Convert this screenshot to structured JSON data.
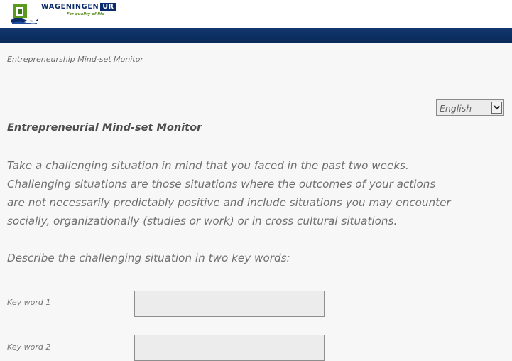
{
  "header": {
    "logo": {
      "wordmark": "WAGENINGEN",
      "badge": "UR",
      "tagline": "For quality of life"
    }
  },
  "breadcrumb": "Entrepreneurship Mind-set Monitor",
  "language_select": {
    "selected": "English"
  },
  "page_title": "Entrepreneurial Mind-set Monitor",
  "intro_lines": [
    "Take a challenging situation in mind that you faced in the past two weeks.",
    "Challenging situations are those situations where the outcomes of your actions",
    "are not necessarily predictably positive and include situations you may encounter",
    "socially, organizationally (studies or work) or in cross cultural situations."
  ],
  "prompt": "Describe the challenging situation in two key words:",
  "fields": [
    {
      "label": "Key word 1",
      "value": ""
    },
    {
      "label": "Key word 2",
      "value": ""
    }
  ],
  "colors": {
    "brand_navy": "#0a2b6b",
    "brand_green": "#5a8a1e",
    "navbar": "#0c2f62",
    "background": "#f7f7f7"
  }
}
